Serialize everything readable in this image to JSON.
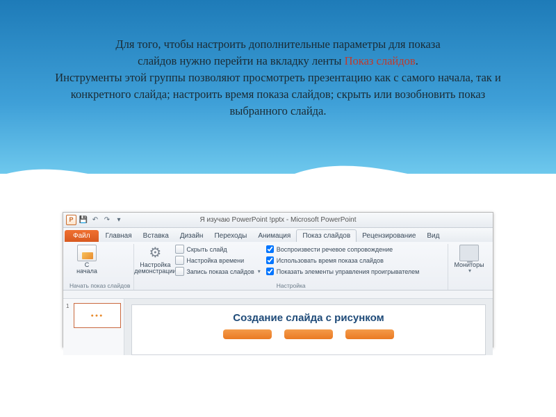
{
  "intro": {
    "p1a": "Для того, чтобы настроить дополнительные параметры для показа",
    "p1b": "слайдов нужно перейти на вкладку ленты ",
    "highlight": "Показ слайдов",
    "p1c": ".",
    "p2": "Инструменты этой группы позволяют просмотреть презентацию как с самого начала, так и конкретного слайда; настроить время показа слайдов; скрыть или возобновить показ выбранного слайда."
  },
  "app": {
    "title": "Я изучаю PowerPoint !pptx  -  Microsoft PowerPoint",
    "qa_letter": "P"
  },
  "tabs": {
    "file": "Файл",
    "items": [
      "Главная",
      "Вставка",
      "Дизайн",
      "Переходы",
      "Анимация",
      "Показ слайдов",
      "Рецензирование",
      "Вид"
    ],
    "active_index": 5
  },
  "ribbon": {
    "group1": {
      "label": "Начать показ слайдов",
      "btn1_l1": "С",
      "btn1_l2": "начала"
    },
    "group2": {
      "btn1_l1": "Настройка",
      "btn1_l2": "демонстрации",
      "items": [
        "Скрыть слайд",
        "Настройка времени",
        "Запись показа слайдов"
      ],
      "checks": [
        "Воспроизвести речевое сопровождение",
        "Использовать время показа слайдов",
        "Показать элементы управления проигрывателем"
      ],
      "label": "Настройка"
    },
    "group3": {
      "btn_l1": "Мониторы"
    }
  },
  "slide": {
    "title": "Создание слайда с рисунком",
    "thumb_num": "1"
  }
}
